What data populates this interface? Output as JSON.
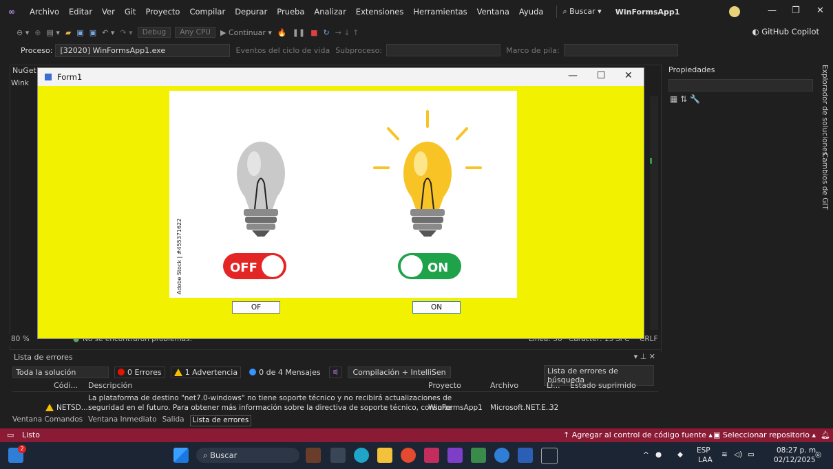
{
  "menubar": {
    "items": [
      "Archivo",
      "Editar",
      "Ver",
      "Git",
      "Proyecto",
      "Compilar",
      "Depurar",
      "Prueba",
      "Analizar",
      "Extensiones",
      "Herramientas",
      "Ventana",
      "Ayuda"
    ],
    "search": "Buscar",
    "solution_name": "WinFormsApp1"
  },
  "toolbar": {
    "config": "Debug",
    "platform": "Any CPU",
    "continue_label": "Continuar",
    "copilot": "GitHub Copilot"
  },
  "process_bar": {
    "process_label": "Proceso:",
    "process_value": "[32020] WinFormsApp1.exe",
    "lifecycle": "Eventos del ciclo de vida",
    "thread_label": "Subproceso:",
    "stack_label": "Marco de pila:"
  },
  "editor": {
    "tab_label": "NuGet",
    "file_tab": "Wink",
    "zoom": "80 %",
    "status_msg": "No se encontraron problemas.",
    "line": "Línea: 56",
    "char": "Carácter: 13",
    "mode": "SPC",
    "eol": "CRLF"
  },
  "properties": {
    "title": "Propiedades"
  },
  "side_tabs": [
    "Explorador de soluciones",
    "Cambios de GIT"
  ],
  "form": {
    "title": "Form1",
    "off_button": "OF",
    "on_button": "ON",
    "image": {
      "off_label": "OFF",
      "on_label": "ON",
      "watermark": "Adobe Stock | #455371622"
    }
  },
  "errors": {
    "title": "Lista de errores",
    "scope": "Toda la solución",
    "errors_chip": "0 Errores",
    "warnings_chip": "1 Advertencia",
    "messages_chip": "0 de 4 Mensajes",
    "build_filter": "Compilación + IntelliSen",
    "search_placeholder": "Lista de errores de búsqueda",
    "columns": [
      "Códi...",
      "Descripción",
      "Proyecto",
      "Archivo",
      "Lí...",
      "Estado suprimido"
    ],
    "row": {
      "code": "NETSD...",
      "desc1": "La plataforma de destino \"net7.0-windows\" no tiene soporte técnico y no recibirá actualizaciones de",
      "desc2": "seguridad en el futuro. Para obtener más información sobre la directiva de soporte técnico, consulte",
      "project": "WinFormsApp1",
      "file": "Microsoft.NET.E...",
      "line": "32"
    },
    "bottom_tabs": [
      "Ventana Comandos",
      "Ventana Inmediato",
      "Salida",
      "Lista de errores"
    ]
  },
  "statusbar": {
    "ready": "Listo",
    "add_source": "Agregar al control de código fuente",
    "select_repo": "Seleccionar repositorio"
  },
  "taskbar": {
    "search": "Buscar",
    "lang": "ESP",
    "lang2": "LAA",
    "time": "08:27 p. m.",
    "date": "02/12/2025",
    "badge": "2"
  },
  "colors": {
    "accent": "#8b1a34",
    "form_bg": "#f2f200",
    "off_red": "#e32526",
    "on_green": "#1fa34a"
  }
}
